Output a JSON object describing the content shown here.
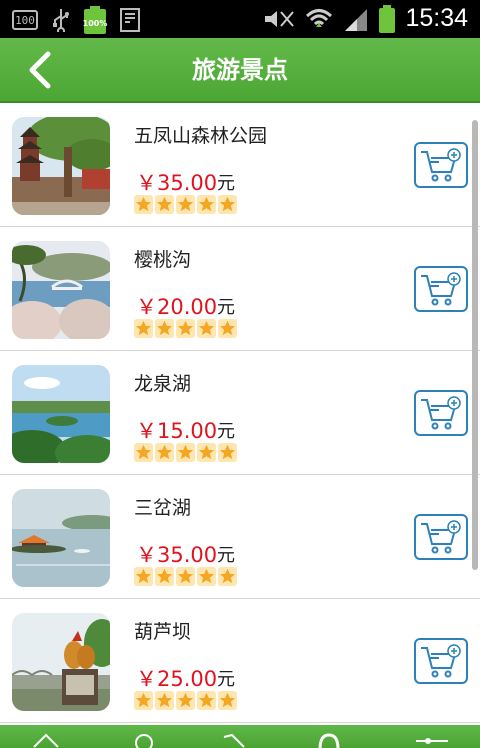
{
  "status_bar": {
    "time": "15:34",
    "left_badge": "100",
    "battery_label": "100%"
  },
  "header": {
    "title": "旅游景点"
  },
  "items": [
    {
      "name": "五凤山森林公园",
      "price": "￥35.00",
      "unit": "元",
      "rating": 5,
      "image": "pagoda-under-tree"
    },
    {
      "name": "樱桃沟",
      "price": "￥20.00",
      "unit": "元",
      "rating": 5,
      "image": "lake-bridge"
    },
    {
      "name": "龙泉湖",
      "price": "￥15.00",
      "unit": "元",
      "rating": 5,
      "image": "lake-aerial"
    },
    {
      "name": "三岔湖",
      "price": "￥35.00",
      "unit": "元",
      "rating": 5,
      "image": "lake-gazebo"
    },
    {
      "name": "葫芦坝",
      "price": "￥25.00",
      "unit": "元",
      "rating": 5,
      "image": "rooster-statue"
    }
  ],
  "colors": {
    "header_green": "#55ad3c",
    "price_red": "#e0141e",
    "cart_blue": "#2c82b8",
    "star_orange": "#f5a623"
  },
  "icons": {
    "back": "chevron-left-icon",
    "cart": "add-to-cart-icon",
    "nav": [
      "home-icon",
      "compass-icon",
      "tag-icon",
      "user-icon",
      "settings-icon"
    ]
  }
}
